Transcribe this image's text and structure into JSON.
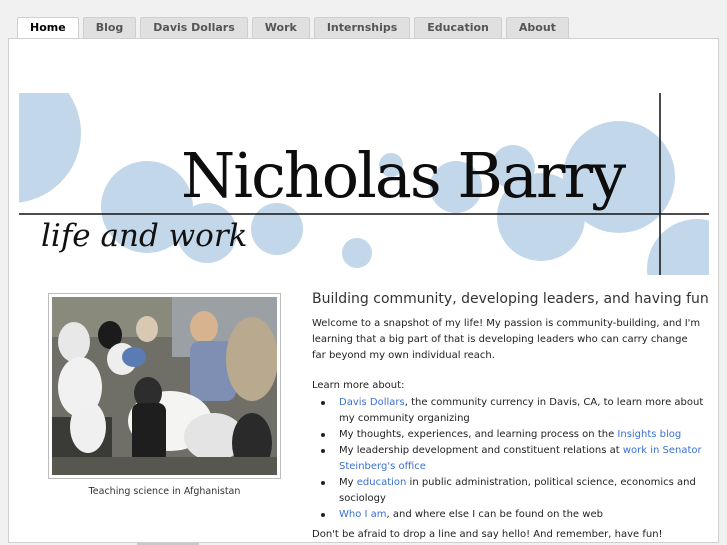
{
  "nav": {
    "tabs": [
      {
        "label": "Home",
        "active": true
      },
      {
        "label": "Blog"
      },
      {
        "label": "Davis Dollars"
      },
      {
        "label": "Work"
      },
      {
        "label": "Internships"
      },
      {
        "label": "Education"
      },
      {
        "label": "About"
      }
    ]
  },
  "banner": {
    "name": "Nicholas Barry",
    "tagline": "life and work",
    "circle_color": "#c3d7ea"
  },
  "photo": {
    "caption": "Teaching science in Afghanistan"
  },
  "main": {
    "headline": "Building community, developing leaders, and having fun",
    "intro": "Welcome to a snapshot of my life! My passion is community-building, and I'm learning that a big part of that is developing leaders who can carry change far beyond my own individual reach.",
    "learn_more": "Learn more about:",
    "items": [
      {
        "link": "Davis Dollars",
        "text": ", the community currency in Davis, CA, to learn more about my community organizing"
      },
      {
        "pre": "My thoughts, experiences, and learning process on the ",
        "link": "Insights blog"
      },
      {
        "pre": "My leadership development and constituent relations at ",
        "link": "work in Senator Steinberg's office"
      },
      {
        "pre": "My ",
        "link": "education",
        "text": " in public administration, political science, economics and sociology"
      },
      {
        "link": "Who I am",
        "text": ", and where else I can be found on the web"
      }
    ],
    "closing": "Don't be afraid to drop a line and say hello! And remember, have fun!"
  },
  "colors": {
    "link": "#3b6fd3",
    "accent": "#c3d7ea"
  }
}
